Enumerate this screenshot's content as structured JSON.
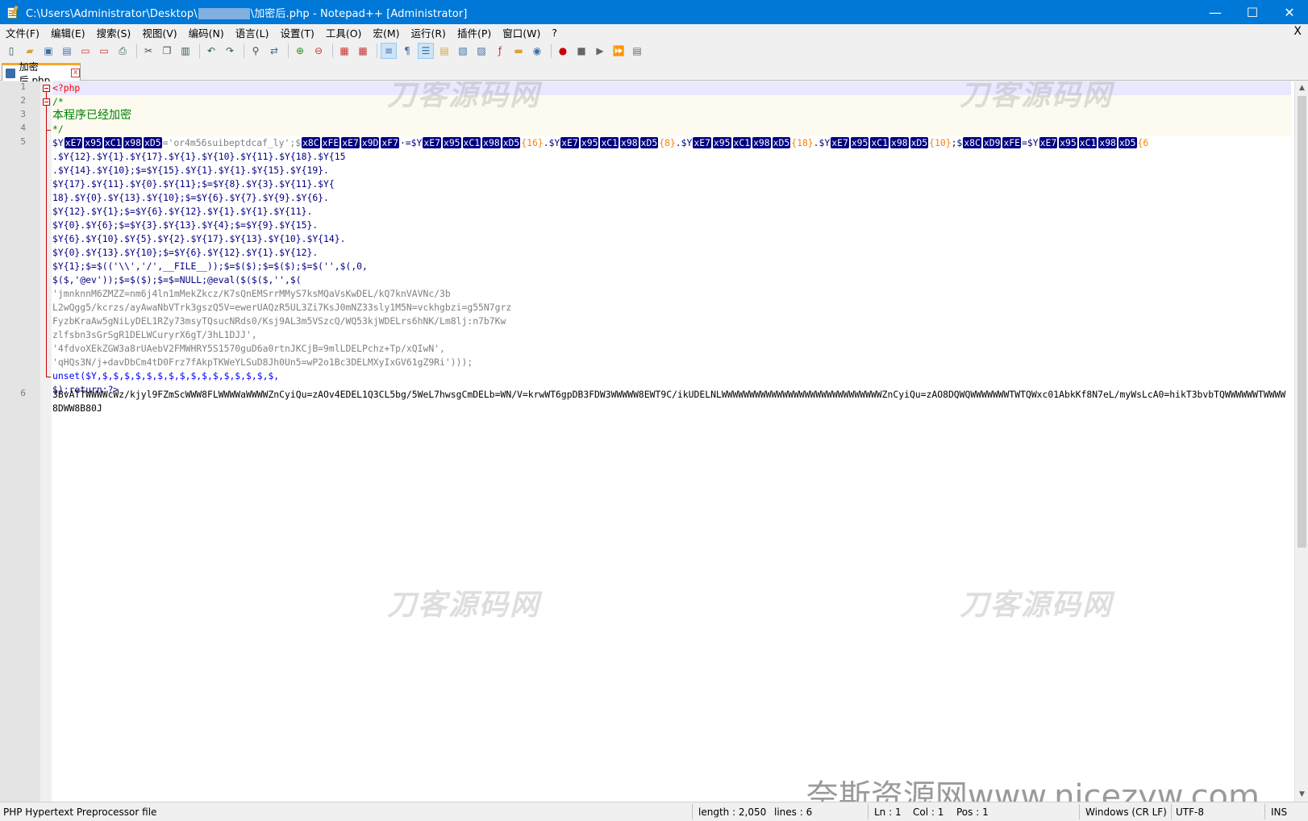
{
  "window": {
    "title_prefix": "C:\\Users\\Administrator\\Desktop\\",
    "title_suffix": "\\加密后.php - Notepad++ [Administrator]",
    "minimize": "—",
    "maximize": "☐",
    "close": "✕"
  },
  "menu": {
    "items": [
      "文件(F)",
      "编辑(E)",
      "搜索(S)",
      "视图(V)",
      "编码(N)",
      "语言(L)",
      "设置(T)",
      "工具(O)",
      "宏(M)",
      "运行(R)",
      "插件(P)",
      "窗口(W)",
      "?"
    ],
    "close_doc": "X"
  },
  "toolbar": {
    "icons": [
      "new-file-icon",
      "open-file-icon",
      "save-icon",
      "save-all-icon",
      "close-icon",
      "close-all-icon",
      "print-icon",
      "cut-icon",
      "copy-icon",
      "paste-icon",
      "undo-icon",
      "redo-icon",
      "find-icon",
      "replace-icon",
      "zoom-in-icon",
      "zoom-out-icon",
      "sync-v-icon",
      "sync-h-icon",
      "word-wrap-icon",
      "all-chars-icon",
      "indent-guide-icon",
      "udl-icon",
      "doc-map-icon",
      "doc-list-icon",
      "function-list-icon",
      "folder-workspace-icon",
      "monitor-icon",
      "record-macro-icon",
      "stop-macro-icon",
      "play-macro-icon",
      "run-macro-multiple-icon",
      "save-macro-icon"
    ]
  },
  "tab": {
    "label": "加密后.php"
  },
  "editor": {
    "line_numbers": [
      "1",
      "2",
      "3",
      "4",
      "5",
      "",
      "",
      "",
      "",
      "",
      "",
      "",
      "",
      "",
      "",
      "",
      "",
      "",
      "",
      "",
      "",
      "",
      "6"
    ],
    "line1": "<?php",
    "line2": "/*",
    "line3": "本程序已经加密",
    "line4": "*/",
    "l5_a_var": "$Y",
    "l5_a_rest": "='or4m56suibeptdcaf_ly';$",
    "l5_row2": ".$Y{12}.$Y{1}.$Y{17}.$Y{1}.$Y{10}.$Y{11}.$Y{18}.$Y{15",
    "l5_row3": ".$Y{14}.$Y{10};$=$Y{15}.$Y{1}.$Y{1}.$Y{15}.$Y{19}.",
    "l5_row4": "$Y{17}.$Y{11}.$Y{0}.$Y{11};$=$Y{8}.$Y{3}.$Y{11}.$Y{",
    "l5_row5": "18}.$Y{0}.$Y{13}.$Y{10};$=$Y{6}.$Y{7}.$Y{9}.$Y{6}.",
    "l5_row6": "$Y{12}.$Y{1};$=$Y{6}.$Y{12}.$Y{1}.$Y{1}.$Y{11}.",
    "l5_row7": "$Y{0}.$Y{6};$=$Y{3}.$Y{13}.$Y{4};$=$Y{9}.$Y{15}.",
    "l5_row8": "$Y{6}.$Y{10}.$Y{5}.$Y{2}.$Y{17}.$Y{13}.$Y{10}.$Y{14}.",
    "l5_row9": "$Y{0}.$Y{13}.$Y{10};$=$Y{6}.$Y{12}.$Y{1}.$Y{12}.",
    "l5_row10": "$Y{1};$=$(('\\\\','/',__FILE__));$=$($);$=$($);$=$('',$(,0,",
    "l5_row11": "$($,'@ev'));$=$($);$=$=NULL;@eval($($($,'',$(",
    "l5_row12": "'jmnknnM6ZMZZ=nm6j4ln1mMekZkcz/K7sQnEMSrrMMyS7ksMQaVsKwDEL/kQ7knVAVNc/3b",
    "l5_row13": "L2wQgg5/kcrzs/ayAwaNbVTrk3gszQ5V=ewerUAQzR5UL3Zi7KsJ0mNZ33sly1M5N=vckhgbzi=g55N7grz",
    "l5_row14": "FyzbKraAw5gNiLyDEL1RZy73msyTQsucNRds0/Ksj9AL3m5VSzcQ/WQ53kjWDELrs6hNK/Lm8lj:n7b7Kw",
    "l5_row15": "zlfsbn3sGrSgR1DELWCuryrX6gT/3hL1DJJ',",
    "l5_row16": "'4fdvoXEkZGW3a8rUAebV2FMWHRY5S1570guD6a0rtnJKCjB=9mlLDELPchz+Tp/xQIwN',",
    "l5_row17": "'qHQs3N/j+davDbCm4tD0Frz7fAkpTKWeYLSuD8Jh0Un5=wP2o1Bc3DELMXyIxGV61gZ9Ri')));",
    "l5_row18": "unset($Y,$,$,$,$,$,$,$,$,$,$,$,$,$,$,$,$,",
    "l5_row19": "$);return;?>",
    "l6_text": "3BvATTWWWWcWz/kjyl9FZmScWWW8FLWWWWaWWWWZnCyiQu=zAOv4EDEL1Q3CL5bg/5WeL7hwsgCmDELb=WN/V=krwWT6gpDB3FDW3WWWWW8EWT9C/ikUDELNLWWWWWWWWWWWWWWWWWWWWWWWWWWWWWZnCyiQu=zAO8DQWQWWWWWWWTWTQWxc01AbkKf8N7eL/myWsLcA0=hikT3bvbTQWWWWWWTWWWW8DWW8B80J"
  },
  "watermark": {
    "top_text": "刀客源码网",
    "bottom_text": "奈斯资源网www.nicezyw.com"
  },
  "status": {
    "file_type": "PHP Hypertext Preprocessor file",
    "length": "length : 2,050",
    "lines": "lines : 6",
    "ln": "Ln : 1",
    "col": "Col : 1",
    "pos": "Pos : 1",
    "eol": "Windows (CR LF)",
    "encoding": "UTF-8",
    "mode": "INS"
  }
}
